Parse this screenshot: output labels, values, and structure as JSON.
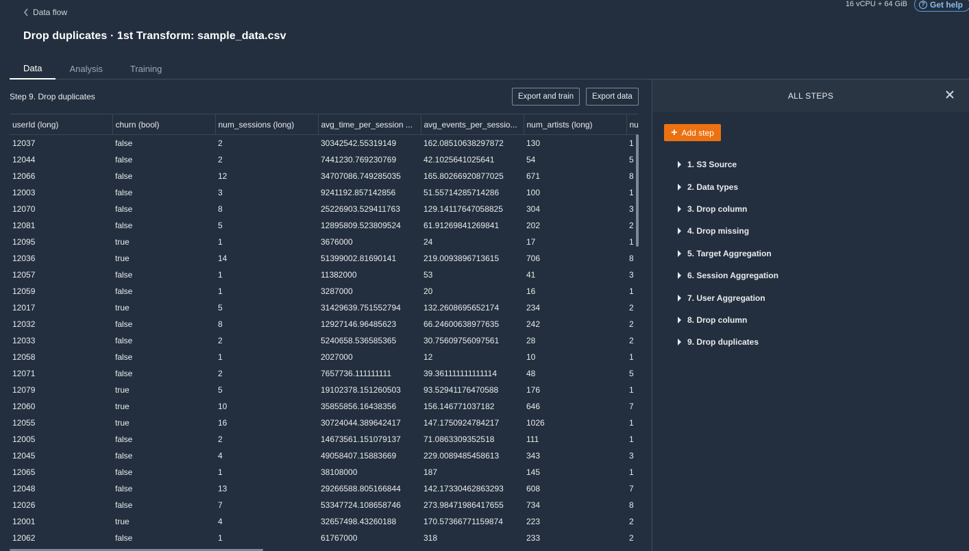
{
  "header": {
    "back_label": "Data flow",
    "resources": "16 vCPU + 64 GiB",
    "help_label": "Get help",
    "title": "Drop duplicates · 1st Transform: sample_data.csv"
  },
  "tabs": [
    {
      "label": "Data",
      "active": true
    },
    {
      "label": "Analysis",
      "active": false
    },
    {
      "label": "Training",
      "active": false
    }
  ],
  "main": {
    "step_label": "Step 9. Drop duplicates",
    "export_train_label": "Export and train",
    "export_data_label": "Export data"
  },
  "table": {
    "columns": [
      "userId (long)",
      "churn (bool)",
      "num_sessions (long)",
      "avg_time_per_session ...",
      "avg_events_per_sessio...",
      "num_artists (long)",
      "nu"
    ],
    "rows": [
      [
        "12037",
        "false",
        "2",
        "30342542.55319149",
        "162.08510638297872",
        "130",
        "1"
      ],
      [
        "12044",
        "false",
        "2",
        "7441230.769230769",
        "42.1025641025641",
        "54",
        "5"
      ],
      [
        "12066",
        "false",
        "12",
        "34707086.749285035",
        "165.80266920877025",
        "671",
        "8"
      ],
      [
        "12003",
        "false",
        "3",
        "9241192.857142856",
        "51.55714285714286",
        "100",
        "1"
      ],
      [
        "12070",
        "false",
        "8",
        "25226903.529411763",
        "129.14117647058825",
        "304",
        "3"
      ],
      [
        "12081",
        "false",
        "5",
        "12895809.523809524",
        "61.91269841269841",
        "202",
        "2"
      ],
      [
        "12095",
        "true",
        "1",
        "3676000",
        "24",
        "17",
        "1"
      ],
      [
        "12036",
        "true",
        "14",
        "51399002.81690141",
        "219.0093896713615",
        "706",
        "8"
      ],
      [
        "12057",
        "false",
        "1",
        "11382000",
        "53",
        "41",
        "3"
      ],
      [
        "12059",
        "false",
        "1",
        "3287000",
        "20",
        "16",
        "1"
      ],
      [
        "12017",
        "true",
        "5",
        "31429639.751552794",
        "132.2608695652174",
        "234",
        "2"
      ],
      [
        "12032",
        "false",
        "8",
        "12927146.96485623",
        "66.24600638977635",
        "242",
        "2"
      ],
      [
        "12033",
        "false",
        "2",
        "5240658.536585365",
        "30.75609756097561",
        "28",
        "2"
      ],
      [
        "12058",
        "false",
        "1",
        "2027000",
        "12",
        "10",
        "1"
      ],
      [
        "12071",
        "false",
        "2",
        "7657736.111111111",
        "39.361111111111114",
        "48",
        "5"
      ],
      [
        "12079",
        "true",
        "5",
        "19102378.151260503",
        "93.52941176470588",
        "176",
        "1"
      ],
      [
        "12060",
        "true",
        "10",
        "35855856.16438356",
        "156.146771037182",
        "646",
        "7"
      ],
      [
        "12055",
        "true",
        "16",
        "30724044.389642417",
        "147.1750924784217",
        "1026",
        "1"
      ],
      [
        "12005",
        "false",
        "2",
        "14673561.151079137",
        "71.0863309352518",
        "111",
        "1"
      ],
      [
        "12045",
        "false",
        "4",
        "49058407.15883669",
        "229.0089485458613",
        "343",
        "3"
      ],
      [
        "12065",
        "false",
        "1",
        "38108000",
        "187",
        "145",
        "1"
      ],
      [
        "12048",
        "false",
        "13",
        "29266588.805166844",
        "142.17330462863293",
        "608",
        "7"
      ],
      [
        "12026",
        "false",
        "7",
        "53347724.108658746",
        "273.98471986417655",
        "734",
        "8"
      ],
      [
        "12001",
        "true",
        "4",
        "32657498.43260188",
        "170.57366771159874",
        "223",
        "2"
      ],
      [
        "12062",
        "false",
        "1",
        "61767000",
        "318",
        "233",
        "2"
      ]
    ]
  },
  "panel": {
    "title": "ALL STEPS",
    "add_step_label": "Add step",
    "steps": [
      "1. S3 Source",
      "2. Data types",
      "3. Drop column",
      "4. Drop missing",
      "5. Target Aggregation",
      "6. Session Aggregation",
      "7. User Aggregation",
      "8. Drop column",
      "9. Drop duplicates"
    ]
  },
  "colors": {
    "background": "#232f3e",
    "accent": "#ec7211",
    "link": "#89bdee"
  }
}
